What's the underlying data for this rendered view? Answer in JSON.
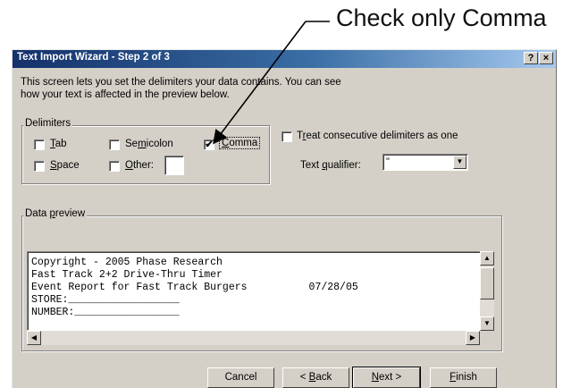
{
  "annotation": {
    "text": "Check only Comma"
  },
  "dialog": {
    "title": "Text Import Wizard - Step 2 of 3",
    "help_button": "?",
    "close_button": "×",
    "description_line1": "This screen lets you set the delimiters your data contains.  You can see",
    "description_line2": "how your text is affected in the preview below."
  },
  "delimiters": {
    "group_label": "Delimiters",
    "tab": {
      "label_key": "T",
      "label_rest": "ab",
      "checked": false
    },
    "semicolon": {
      "label_pre": "Se",
      "label_key": "m",
      "label_rest": "icolon",
      "checked": false
    },
    "comma": {
      "label_key": "C",
      "label_rest": "omma",
      "checked": true,
      "mark": "✔"
    },
    "space": {
      "label_key": "S",
      "label_rest": "pace",
      "checked": false
    },
    "other": {
      "label_key": "O",
      "label_rest": "ther:",
      "checked": false,
      "value": ""
    }
  },
  "consecutive": {
    "label_pre": "T",
    "label_key": "r",
    "label_rest": "eat consecutive delimiters as one",
    "checked": false
  },
  "qualifier": {
    "label_pre": "Text ",
    "label_key": "q",
    "label_rest": "ualifier:",
    "value": "\""
  },
  "preview": {
    "group_label_pre": "Data ",
    "group_label_key": "p",
    "group_label_rest": "review",
    "lines": [
      "Copyright - 2005 Phase Research",
      "Fast Track 2+2 Drive-Thru Timer",
      "Event Report for Fast Track Burgers          07/28/05",
      "STORE:__________________",
      "NUMBER:_________________"
    ]
  },
  "buttons": {
    "cancel": "Cancel",
    "back_pre": "< ",
    "back_key": "B",
    "back_rest": "ack",
    "next_key": "N",
    "next_rest": "ext >",
    "finish_key": "F",
    "finish_rest": "inish"
  },
  "scroll_icons": {
    "up": "▲",
    "down": "▼",
    "left": "◀",
    "right": "▶",
    "dropdown": "▼"
  }
}
